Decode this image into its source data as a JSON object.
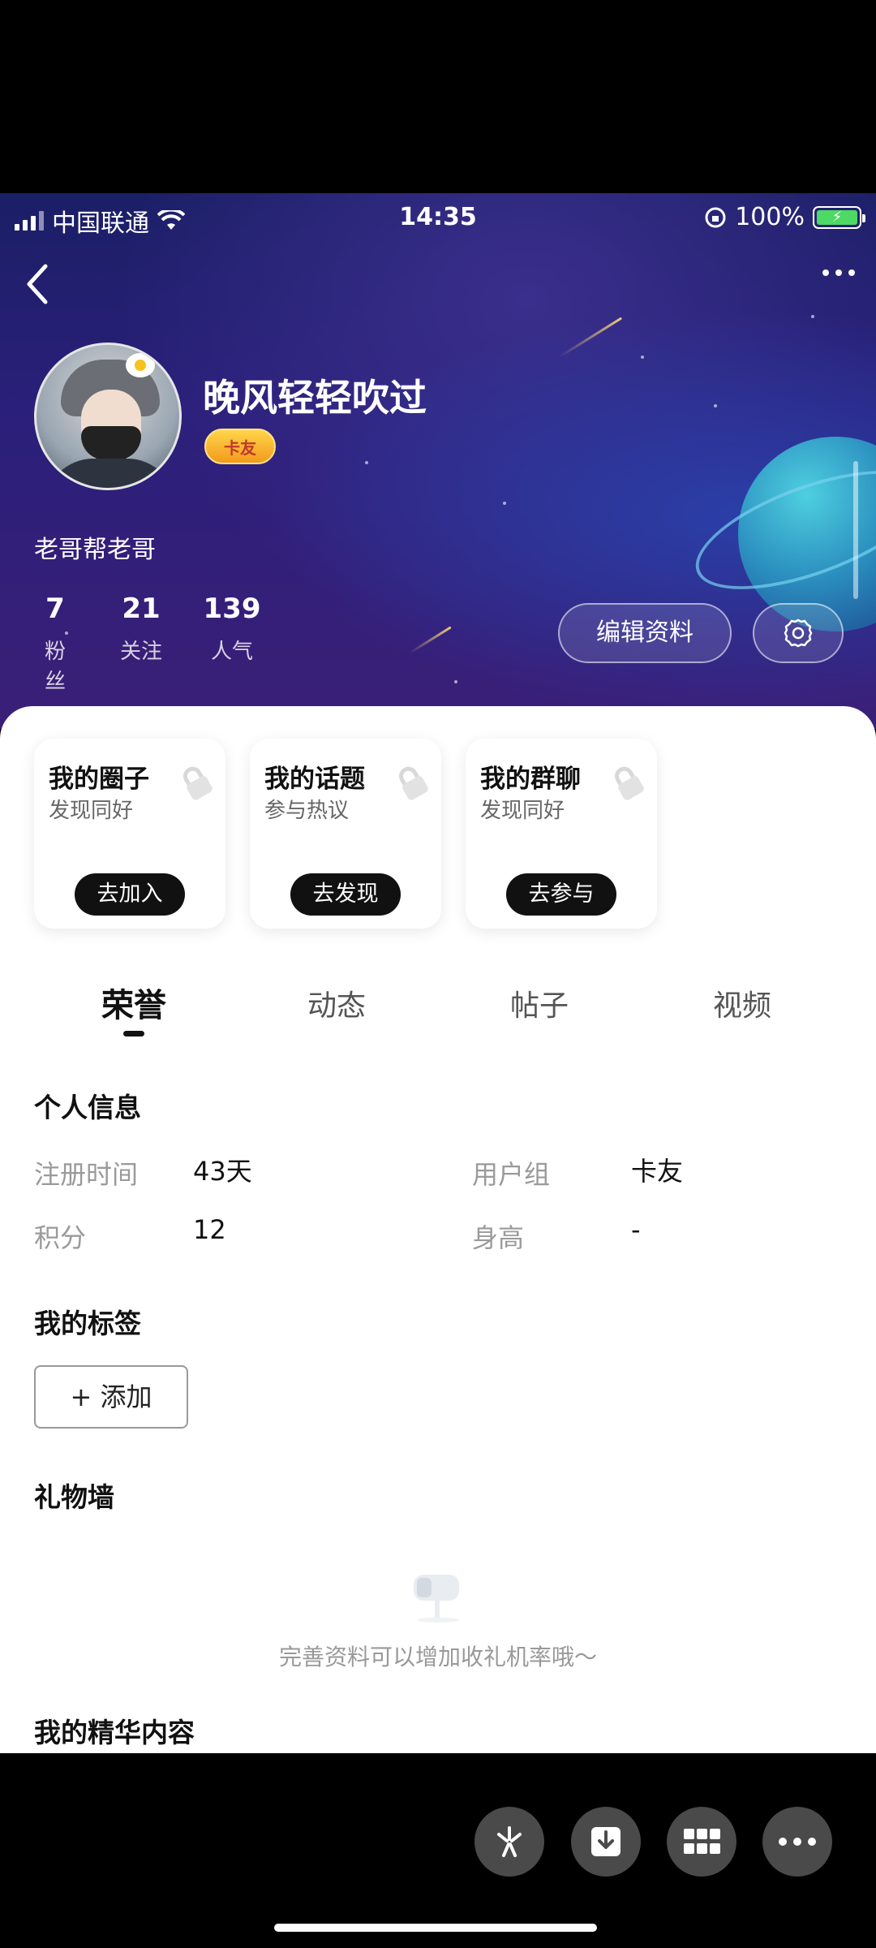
{
  "status_bar": {
    "carrier": "中国联通",
    "time": "14:35",
    "battery": "100%"
  },
  "profile": {
    "username": "晚风轻轻吹过",
    "badge": "卡友",
    "bio": "老哥帮老哥",
    "stats": [
      {
        "value": "7",
        "label": "粉丝"
      },
      {
        "value": "21",
        "label": "关注"
      },
      {
        "value": "139",
        "label": "人气"
      }
    ],
    "edit_button": "编辑资料"
  },
  "cards": [
    {
      "title": "我的圈子",
      "subtitle": "发现同好",
      "action": "去加入"
    },
    {
      "title": "我的话题",
      "subtitle": "参与热议",
      "action": "去发现"
    },
    {
      "title": "我的群聊",
      "subtitle": "发现同好",
      "action": "去参与"
    }
  ],
  "tabs": [
    "荣誉",
    "动态",
    "帖子",
    "视频"
  ],
  "active_tab": "荣誉",
  "personal_info": {
    "title": "个人信息",
    "fields": [
      {
        "label": "注册时间",
        "value": "43天"
      },
      {
        "label": "用户组",
        "value": "卡友"
      },
      {
        "label": "积分",
        "value": "12"
      },
      {
        "label": "身高",
        "value": "-"
      }
    ]
  },
  "tags": {
    "title": "我的标签",
    "add_button": "+ 添加"
  },
  "gift_wall": {
    "title": "礼物墙",
    "empty_text": "完善资料可以增加收礼机率哦～"
  },
  "featured": {
    "title": "我的精华内容"
  },
  "colors": {
    "hero_bg": "#2a1f7a",
    "badge": "#f29a1c",
    "accent_dark": "#111111"
  },
  "icons": [
    "back-icon",
    "more-icon",
    "gear-icon",
    "lock-icon",
    "mailbox-icon",
    "sparkle-icon",
    "download-icon",
    "grid-icon",
    "ellipsis-icon"
  ]
}
